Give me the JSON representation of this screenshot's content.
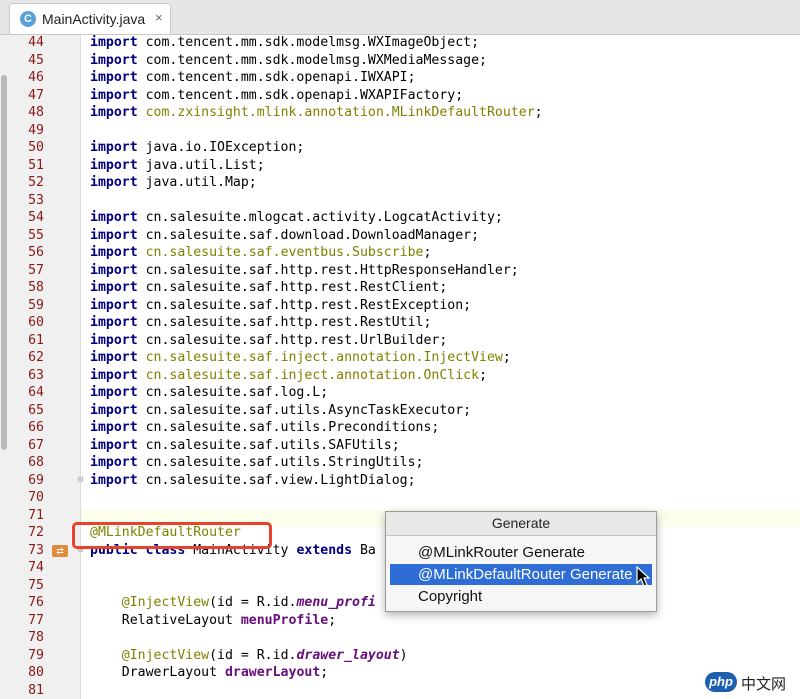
{
  "tab": {
    "icon_letter": "C",
    "title": "MainActivity.java",
    "close": "×"
  },
  "lines": [
    {
      "n": "44",
      "segs": [
        [
          "kw",
          "import"
        ],
        [
          "n",
          " com.tencent.mm.sdk.modelmsg.WXImageObject;"
        ]
      ]
    },
    {
      "n": "45",
      "segs": [
        [
          "kw",
          "import"
        ],
        [
          "n",
          " com.tencent.mm.sdk.modelmsg.WXMediaMessage;"
        ]
      ]
    },
    {
      "n": "46",
      "segs": [
        [
          "kw",
          "import"
        ],
        [
          "n",
          " com.tencent.mm.sdk.openapi.IWXAPI;"
        ]
      ]
    },
    {
      "n": "47",
      "segs": [
        [
          "kw",
          "import"
        ],
        [
          "n",
          " com.tencent.mm.sdk.openapi.WXAPIFactory;"
        ]
      ]
    },
    {
      "n": "48",
      "segs": [
        [
          "kw",
          "import"
        ],
        [
          "n",
          " "
        ],
        [
          "dim",
          "com.zxinsight.mlink.annotation.MLinkDefaultRouter"
        ],
        [
          "n",
          ";"
        ]
      ]
    },
    {
      "n": "49",
      "segs": []
    },
    {
      "n": "50",
      "segs": [
        [
          "kw",
          "import"
        ],
        [
          "n",
          " java.io.IOException;"
        ]
      ]
    },
    {
      "n": "51",
      "segs": [
        [
          "kw",
          "import"
        ],
        [
          "n",
          " java.util.List;"
        ]
      ]
    },
    {
      "n": "52",
      "segs": [
        [
          "kw",
          "import"
        ],
        [
          "n",
          " java.util.Map;"
        ]
      ]
    },
    {
      "n": "53",
      "segs": []
    },
    {
      "n": "54",
      "segs": [
        [
          "kw",
          "import"
        ],
        [
          "n",
          " cn.salesuite.mlogcat.activity.LogcatActivity;"
        ]
      ]
    },
    {
      "n": "55",
      "segs": [
        [
          "kw",
          "import"
        ],
        [
          "n",
          " cn.salesuite.saf.download.DownloadManager;"
        ]
      ]
    },
    {
      "n": "56",
      "segs": [
        [
          "kw",
          "import"
        ],
        [
          "n",
          " "
        ],
        [
          "dim",
          "cn.salesuite.saf.eventbus.Subscribe"
        ],
        [
          "n",
          ";"
        ]
      ]
    },
    {
      "n": "57",
      "segs": [
        [
          "kw",
          "import"
        ],
        [
          "n",
          " cn.salesuite.saf.http.rest.HttpResponseHandler;"
        ]
      ]
    },
    {
      "n": "58",
      "segs": [
        [
          "kw",
          "import"
        ],
        [
          "n",
          " cn.salesuite.saf.http.rest.RestClient;"
        ]
      ]
    },
    {
      "n": "59",
      "segs": [
        [
          "kw",
          "import"
        ],
        [
          "n",
          " cn.salesuite.saf.http.rest.RestException;"
        ]
      ]
    },
    {
      "n": "60",
      "segs": [
        [
          "kw",
          "import"
        ],
        [
          "n",
          " cn.salesuite.saf.http.rest.RestUtil;"
        ]
      ]
    },
    {
      "n": "61",
      "segs": [
        [
          "kw",
          "import"
        ],
        [
          "n",
          " cn.salesuite.saf.http.rest.UrlBuilder;"
        ]
      ]
    },
    {
      "n": "62",
      "segs": [
        [
          "kw",
          "import"
        ],
        [
          "n",
          " "
        ],
        [
          "dim",
          "cn.salesuite.saf.inject.annotation.InjectView"
        ],
        [
          "n",
          ";"
        ]
      ]
    },
    {
      "n": "63",
      "segs": [
        [
          "kw",
          "import"
        ],
        [
          "n",
          " "
        ],
        [
          "dim",
          "cn.salesuite.saf.inject.annotation.OnClick"
        ],
        [
          "n",
          ";"
        ]
      ]
    },
    {
      "n": "64",
      "segs": [
        [
          "kw",
          "import"
        ],
        [
          "n",
          " cn.salesuite.saf.log.L;"
        ]
      ]
    },
    {
      "n": "65",
      "segs": [
        [
          "kw",
          "import"
        ],
        [
          "n",
          " cn.salesuite.saf.utils.AsyncTaskExecutor;"
        ]
      ]
    },
    {
      "n": "66",
      "segs": [
        [
          "kw",
          "import"
        ],
        [
          "n",
          " cn.salesuite.saf.utils.Preconditions;"
        ]
      ]
    },
    {
      "n": "67",
      "segs": [
        [
          "kw",
          "import"
        ],
        [
          "n",
          " cn.salesuite.saf.utils.SAFUtils;"
        ]
      ]
    },
    {
      "n": "68",
      "segs": [
        [
          "kw",
          "import"
        ],
        [
          "n",
          " cn.salesuite.saf.utils.StringUtils;"
        ]
      ]
    },
    {
      "n": "69",
      "segs": [
        [
          "kw",
          "import"
        ],
        [
          "n",
          " cn.salesuite.saf.view.LightDialog;"
        ]
      ]
    },
    {
      "n": "70",
      "segs": []
    },
    {
      "n": "71",
      "segs": []
    },
    {
      "n": "72",
      "segs": [
        [
          "ann",
          "@MLinkDefaultRouter"
        ]
      ]
    },
    {
      "n": "73",
      "segs": [
        [
          "kw",
          "public class"
        ],
        [
          "n",
          " MainActivity "
        ],
        [
          "kw",
          "extends"
        ],
        [
          "n",
          " Ba"
        ]
      ]
    },
    {
      "n": "74",
      "segs": []
    },
    {
      "n": "75",
      "segs": []
    },
    {
      "n": "76",
      "segs": [
        [
          "n",
          "    "
        ],
        [
          "ann",
          "@InjectView"
        ],
        [
          "n",
          "(id = R.id."
        ],
        [
          "italic",
          "menu_profi"
        ]
      ]
    },
    {
      "n": "77",
      "segs": [
        [
          "n",
          "    RelativeLayout "
        ],
        [
          "field",
          "menuProfile"
        ],
        [
          "n",
          ";"
        ]
      ]
    },
    {
      "n": "78",
      "segs": []
    },
    {
      "n": "79",
      "segs": [
        [
          "n",
          "    "
        ],
        [
          "ann",
          "@InjectView"
        ],
        [
          "n",
          "(id = R.id."
        ],
        [
          "italic",
          "drawer_layout"
        ],
        [
          "n",
          ")"
        ]
      ]
    },
    {
      "n": "80",
      "segs": [
        [
          "n",
          "    DrawerLayout "
        ],
        [
          "field",
          "drawerLayout"
        ],
        [
          "n",
          ";"
        ]
      ]
    },
    {
      "n": "81",
      "segs": []
    }
  ],
  "popup": {
    "title": "Generate",
    "items": [
      "@MLinkRouter Generate",
      "@MLinkDefaultRouter Generate",
      "Copyright"
    ],
    "selected_index": 1
  },
  "watermark": {
    "badge": "php",
    "text": "中文网"
  },
  "colors": {
    "keyword": "#000080",
    "annotation": "#808000",
    "line_number": "#8b1a1a",
    "selection": "#2f6dd6",
    "highlight_box": "#e8412d"
  }
}
